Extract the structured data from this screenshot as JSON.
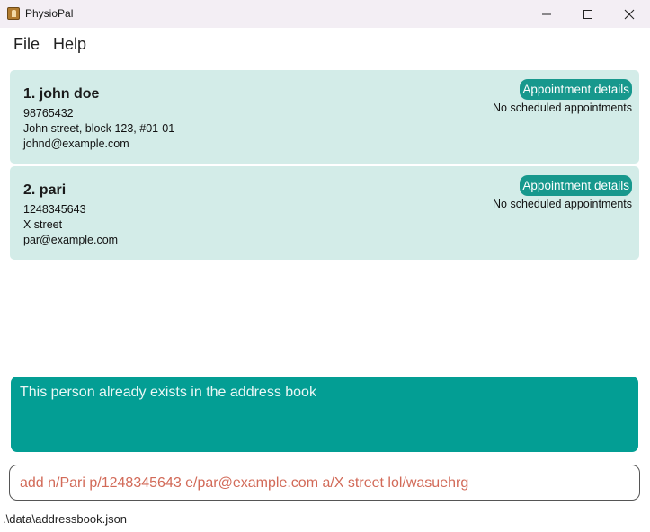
{
  "window": {
    "title": "PhysioPal",
    "icon": "app-icon"
  },
  "menu": {
    "file": "File",
    "help": "Help"
  },
  "persons": [
    {
      "index_name": "1. john doe",
      "phone": "98765432",
      "address": "John street, block 123, #01-01",
      "email": "johnd@example.com",
      "appointment_button": "Appointment details",
      "appointment_status": "No scheduled appointments"
    },
    {
      "index_name": "2. pari",
      "phone": "1248345643",
      "address": "X street",
      "email": "par@example.com",
      "appointment_button": "Appointment details",
      "appointment_status": "No scheduled appointments"
    }
  ],
  "result": {
    "message": "This person already exists in the address book"
  },
  "command": {
    "value": "add n/Pari p/1248345643 e/par@example.com a/X street lol/wasuehrg"
  },
  "status": {
    "path": ".\\data\\addressbook.json"
  },
  "colors": {
    "card_bg": "#d3ece8",
    "accent": "#17988d",
    "result_bg": "#039e94",
    "command_error_text": "#d26a58"
  }
}
